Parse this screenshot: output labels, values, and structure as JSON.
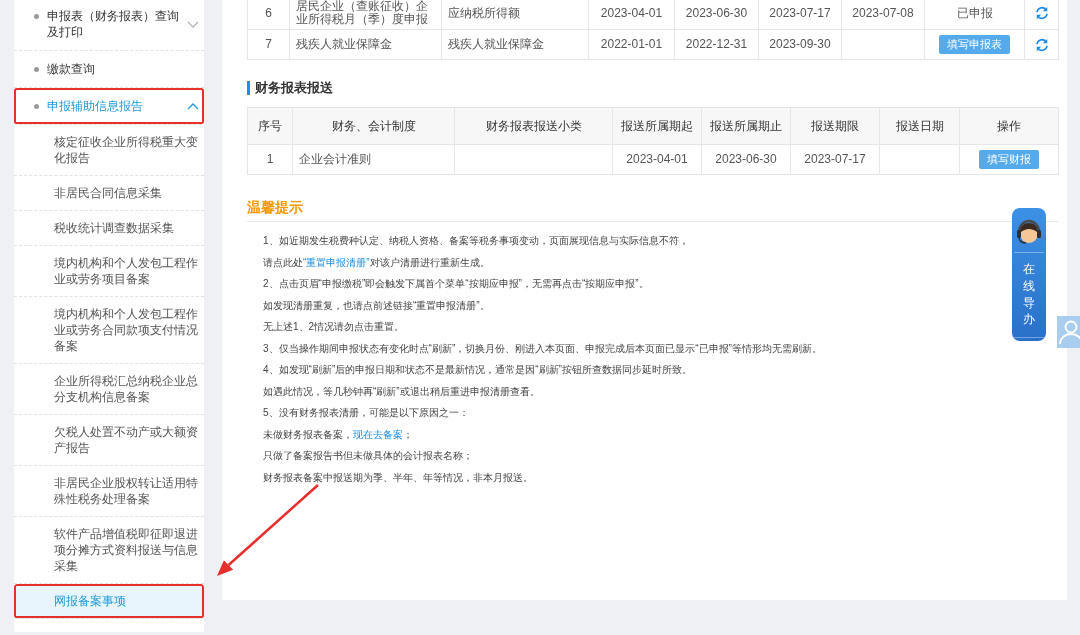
{
  "sidebar": {
    "items": [
      {
        "label": "申报表（财务报表）查询及打印",
        "selected": false,
        "annotated": false,
        "expanded": false
      },
      {
        "label": "缴款查询",
        "selected": false,
        "annotated": false
      },
      {
        "label": "申报辅助信息报告",
        "selected": true,
        "annotated": true,
        "expanded": true,
        "children": [
          {
            "label": "核定征收企业所得税重大变化报告",
            "selected": false,
            "annotated": false
          },
          {
            "label": "非居民合同信息采集",
            "selected": false,
            "annotated": false
          },
          {
            "label": "税收统计调查数据采集",
            "selected": false,
            "annotated": false
          },
          {
            "label": "境内机构和个人发包工程作业或劳务项目备案",
            "selected": false,
            "annotated": false
          },
          {
            "label": "境内机构和个人发包工程作业或劳务合同款项支付情况备案",
            "selected": false,
            "annotated": false
          },
          {
            "label": "企业所得税汇总纳税企业总分支机构信息备案",
            "selected": false,
            "annotated": false
          },
          {
            "label": "欠税人处置不动产或大额资产报告",
            "selected": false,
            "annotated": false
          },
          {
            "label": "非居民企业股权转让适用特殊性税务处理备案",
            "selected": false,
            "annotated": false
          },
          {
            "label": "软件产品增值税即征即退进项分摊方式资料报送与信息采集",
            "selected": false,
            "annotated": false
          },
          {
            "label": "网报备案事项",
            "selected": true,
            "annotated": true
          }
        ]
      }
    ]
  },
  "declaration_table": {
    "rows": [
      {
        "column_1": "6",
        "column_2": "居民企业（查账征收）企业所得税月（季）度申报",
        "column_3": "应纳税所得额",
        "column_4": "2023-04-01",
        "column_5": "2023-06-30",
        "column_6": "2023-07-17",
        "column_7": "2023-07-08",
        "column_8": {
          "kind": "text",
          "label": "已申报"
        }
      },
      {
        "column_1": "7",
        "column_2": "残疾人就业保障金",
        "column_3": "残疾人就业保障金",
        "column_4": "2022-01-01",
        "column_5": "2022-12-31",
        "column_6": "2023-09-30",
        "column_8": {
          "kind": "button",
          "label": "填写申报表"
        }
      }
    ]
  },
  "finance_section": {
    "title": "财务报表报送",
    "table": {
      "columns": [
        "序号",
        "财务、会计制度",
        "财务报表报送小类",
        "报送所属期起",
        "报送所属期止",
        "报送期限",
        "报送日期",
        "操作"
      ],
      "rows": [
        {
          "seq": "1",
          "accounting_system": "企业会计准则",
          "period_start": "2023-04-01",
          "period_end": "2023-06-30",
          "deadline": "2023-07-17",
          "operation": {
            "kind": "button",
            "label": "填写财报"
          }
        }
      ]
    }
  },
  "tips": {
    "title": "温馨提示",
    "lines": [
      {
        "parts": [
          {
            "kind": "text",
            "text": "1、如近期发生税费种认定、纳税人资格、备案等税务事项变动，页面展现信息与实际信息不符，"
          }
        ]
      },
      {
        "parts": [
          {
            "kind": "text",
            "text": "请点此处"
          },
          {
            "kind": "link",
            "text": "“重置申报清册”"
          },
          {
            "kind": "text",
            "text": "对该户清册进行重新生成。"
          }
        ]
      },
      {
        "parts": [
          {
            "kind": "text",
            "text": "2、点击页眉“申报缴税”即会触发下属首个菜单“按期应申报”，无需再点击“按期应申报”。"
          }
        ]
      },
      {
        "parts": [
          {
            "kind": "text",
            "text": "如发现清册重复，也请点前述链接“重置申报清册”。"
          }
        ]
      },
      {
        "parts": [
          {
            "kind": "text",
            "text": "无上述1、2情况请勿点击重置。"
          }
        ]
      },
      {
        "parts": [
          {
            "kind": "text",
            "text": "3、仅当操作期间申报状态有变化时点“刷新”，切换月份、刚进入本页面、申报完成后本页面已显示“已申报”等情形均无需刷新。"
          }
        ]
      },
      {
        "parts": [
          {
            "kind": "text",
            "text": "4、如发现“刷新”后的申报日期和状态不是最新情况，通常是因“刷新”按钮所查数据同步延时所致。"
          }
        ]
      },
      {
        "parts": [
          {
            "kind": "text",
            "text": "如遇此情况，等几秒钟再“刷新”或退出稍后重进申报清册查看。"
          }
        ]
      },
      {
        "parts": [
          {
            "kind": "text",
            "text": "5、没有财务报表清册，可能是以下原因之一："
          }
        ]
      },
      {
        "parts": [
          {
            "kind": "text",
            "text": "未做财务报表备案，"
          },
          {
            "kind": "link",
            "text": "现在去备案"
          },
          {
            "kind": "text",
            "text": "；"
          }
        ]
      },
      {
        "parts": [
          {
            "kind": "text",
            "text": "只做了备案报告书但未做具体的会计报表名称；"
          }
        ]
      },
      {
        "parts": [
          {
            "kind": "text",
            "text": "财务报表备案中报送期为季、半年、年等情况，非本月报送。"
          }
        ]
      }
    ]
  },
  "guide_widget": {
    "label": "在线导办"
  }
}
